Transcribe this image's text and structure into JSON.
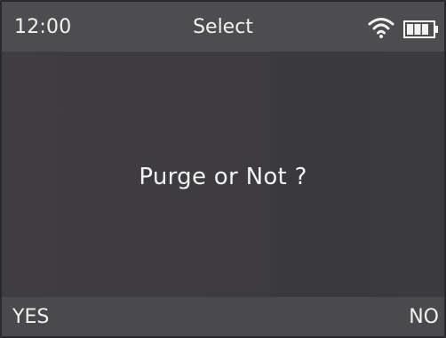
{
  "status_bar": {
    "time": "12:00",
    "title": "Select",
    "wifi_icon": "wifi-icon",
    "battery_icon": "battery-icon"
  },
  "dialog": {
    "message": "Purge or Not ?"
  },
  "softkeys": {
    "left_label": "YES",
    "right_label": "NO"
  },
  "colors": {
    "background": "#3c3b3e",
    "status_bar": "#4d4d50",
    "softkey_bar": "#4a494c",
    "text": "#f2f2f2"
  }
}
